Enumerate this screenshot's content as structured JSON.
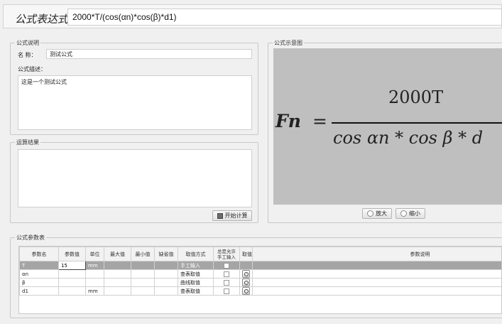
{
  "header": {
    "title": "公式表达式",
    "expression": "2000*T/(cos(αn)*cos(β)*d1)"
  },
  "desc_group": {
    "legend": "公式说明",
    "name_label": "名 称：",
    "name_value": "测试公式",
    "desc_label": "公式描述：",
    "desc_value": "这是一个测试公式"
  },
  "result_group": {
    "legend": "运算结果",
    "calc_button": "开始计算"
  },
  "diagram_group": {
    "legend": "公式示意图",
    "zoom_in": "放大",
    "zoom_out": "缩小"
  },
  "formula": {
    "lhs": "Fn",
    "eq": "=",
    "numerator": "2000T",
    "denominator": "cos αn * cos β * d"
  },
  "params_group": {
    "legend": "公式参数表",
    "columns": [
      "参数名",
      "参数值",
      "单位",
      "最大值",
      "最小值",
      "缺省值",
      "取值方式",
      "总是允许手工输入",
      "取值",
      "参数说明"
    ],
    "rows": [
      {
        "name": "T",
        "value": "15",
        "unit": "mm",
        "max": "",
        "min": "",
        "default": "",
        "method": "手工输入",
        "allow": false,
        "pick": false,
        "desc": ""
      },
      {
        "name": "αn",
        "value": "",
        "unit": "",
        "max": "",
        "min": "",
        "default": "",
        "method": "查表取值",
        "allow": false,
        "pick": true,
        "desc": ""
      },
      {
        "name": "β",
        "value": "",
        "unit": "",
        "max": "",
        "min": "",
        "default": "",
        "method": "曲线取值",
        "allow": false,
        "pick": true,
        "desc": ""
      },
      {
        "name": "d1",
        "value": "",
        "unit": "mm",
        "max": "",
        "min": "",
        "default": "",
        "method": "查表取值",
        "allow": false,
        "pick": true,
        "desc": ""
      }
    ]
  },
  "colors": {
    "selected_row": "#a5a5a5",
    "diagram_bg": "#bfbfbf"
  }
}
